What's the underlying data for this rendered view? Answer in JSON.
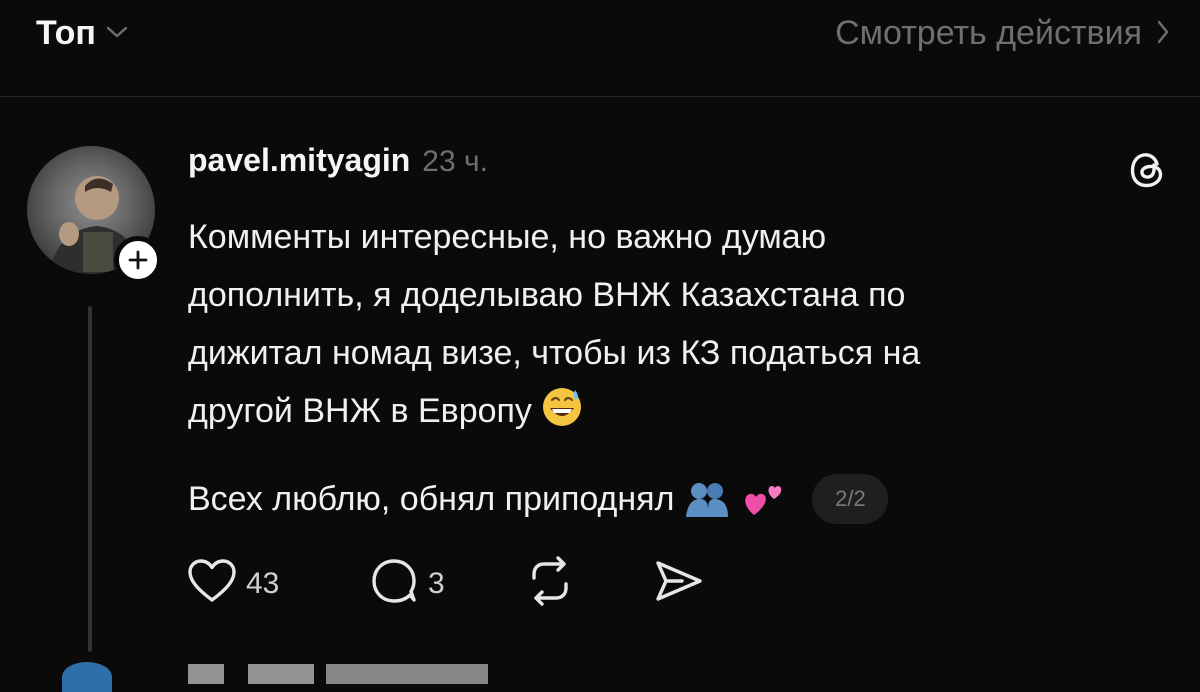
{
  "header": {
    "sort_label": "Топ",
    "view_activity_label": "Смотреть действия"
  },
  "post": {
    "username": "pavel.mityagin",
    "timestamp": "23 ч.",
    "body_lines": [
      "Комменты интересные, но важно думаю",
      "дополнить, я доделываю ВНЖ Казахстана по",
      "дижитал номад визе, чтобы из КЗ податься на",
      "другой ВНЖ в Европу"
    ],
    "second_line": "Всех люблю, обнял приподнял",
    "page_indicator": "2/2",
    "likes": "43",
    "replies": "3",
    "icons": {
      "like": "heart-icon",
      "reply": "comment-icon",
      "repost": "repost-icon",
      "share": "send-icon",
      "platform": "threads-logo-icon",
      "follow": "plus-icon"
    },
    "emojis": [
      "grinning-face-with-sweat",
      "people-hugging",
      "two-hearts"
    ]
  },
  "colors": {
    "background": "#0a0a0a",
    "primary_text": "#f3f3f3",
    "secondary_text": "#6f6f6f",
    "divider": "#262626"
  }
}
